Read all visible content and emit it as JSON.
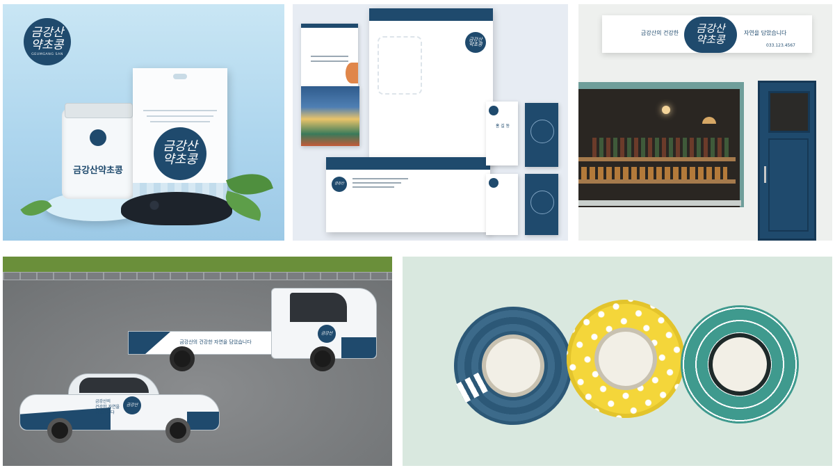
{
  "brand": {
    "logo_line1": "금강산",
    "logo_line2": "약초콩",
    "logo_sub": "GEUMGANG SAN"
  },
  "packaging": {
    "jar_label": "금강산약초콩"
  },
  "storefront": {
    "sign_left": "금강산의 건강한",
    "sign_right": "자연을 담았습니다",
    "phone": "033.123.4567"
  },
  "stationery": {
    "card_name": "홍 길 동"
  },
  "vehicles": {
    "truck_slogan": "금강산의 건강한 자연을 담았습니다",
    "car_slogan_1": "금강산의",
    "car_slogan_2": "건강한 자연을",
    "car_slogan_3": "담았습니다"
  },
  "colors": {
    "navy": "#1f4a6d",
    "sky": "#aed6ee",
    "tape_yellow": "#f4d63a",
    "tape_teal": "#3f9a8e",
    "mint_bg": "#d9e8df"
  }
}
